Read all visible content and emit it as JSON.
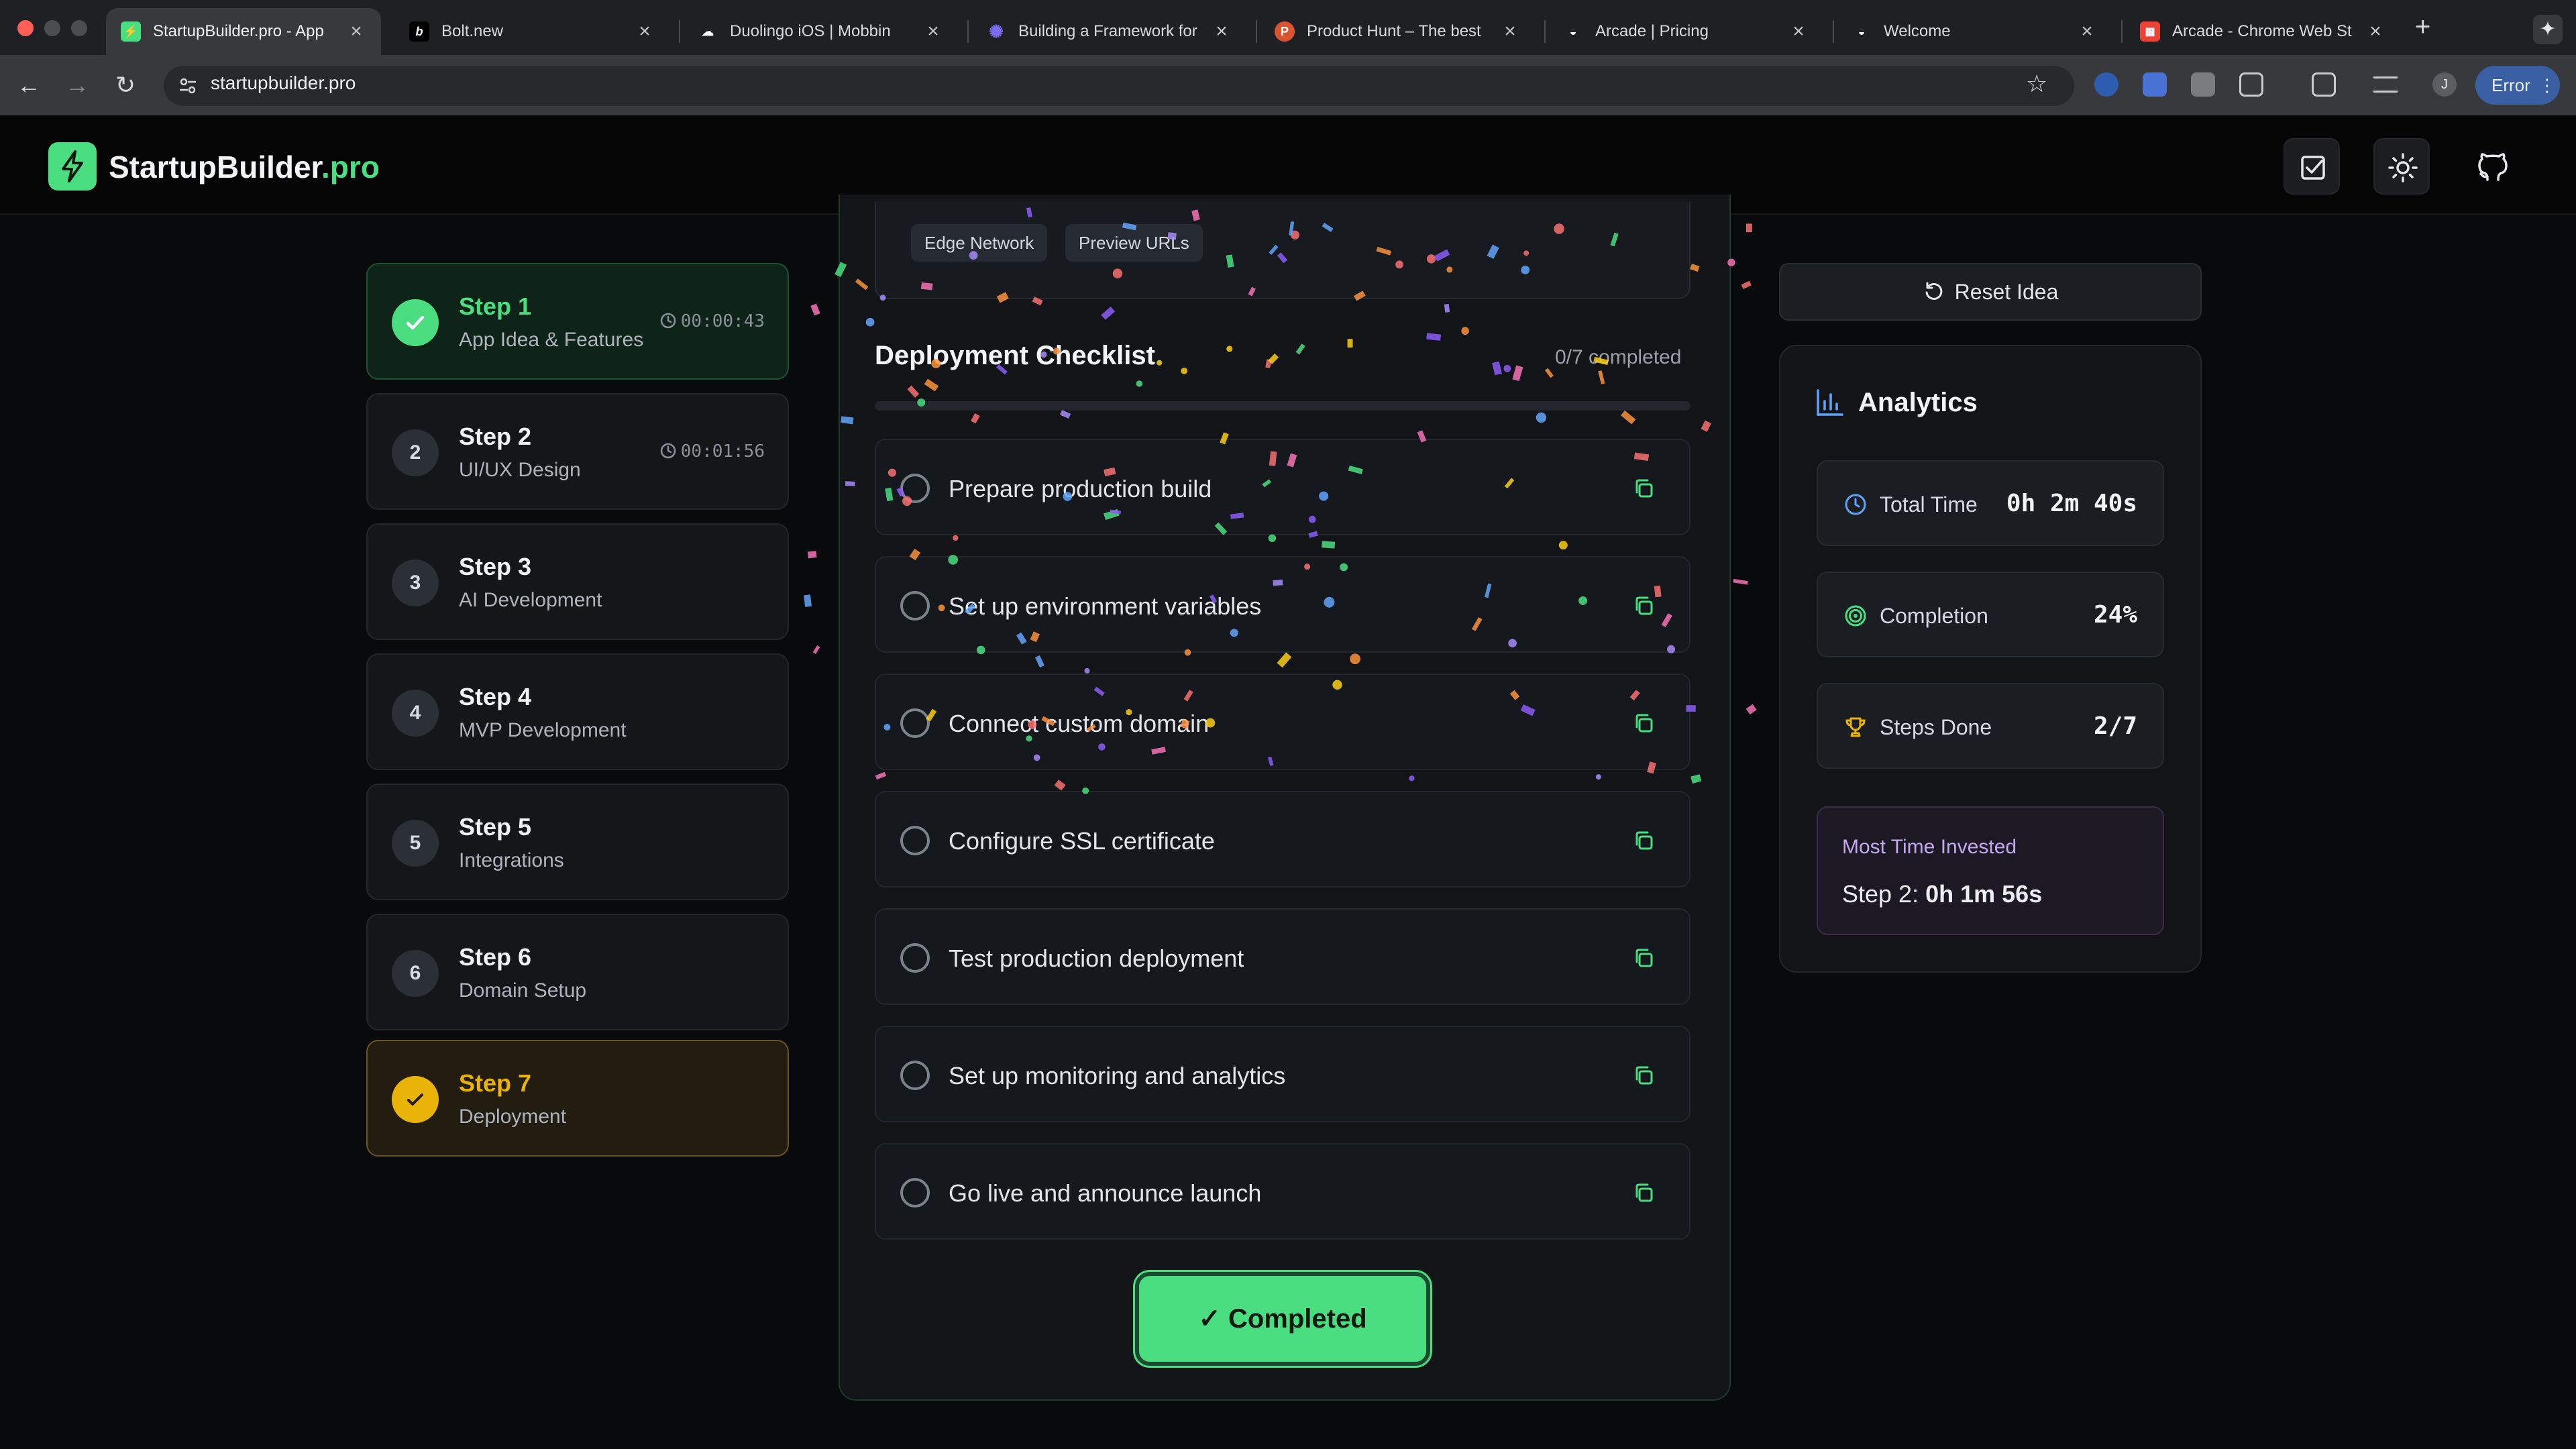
{
  "browser": {
    "tabs": [
      {
        "title": "StartupBuilder.pro - App",
        "icon": "bolt-favicon",
        "color": "#4ade80"
      },
      {
        "title": "Bolt.new",
        "icon": "b-favicon",
        "color": "#000000"
      },
      {
        "title": "Duolingo iOS | Mobbin",
        "icon": "cloud-favicon",
        "color": "#ffffff"
      },
      {
        "title": "Building a Framework for",
        "icon": "gear-favicon",
        "color": "#7c6cf0"
      },
      {
        "title": "Product Hunt – The best",
        "icon": "p-favicon",
        "color": "#da552f"
      },
      {
        "title": "Arcade | Pricing",
        "icon": "arcade-favicon",
        "color": "#ffffff"
      },
      {
        "title": "Welcome",
        "icon": "arcade-favicon",
        "color": "#ffffff"
      },
      {
        "title": "Arcade - Chrome Web St",
        "icon": "chrome-store-favicon",
        "color": "#ea4335"
      }
    ],
    "url": "startupbuilder.pro",
    "error_label": "Error",
    "profile_initial": "J"
  },
  "header": {
    "brand_main": "StartupBuilder",
    "brand_accent": ".pro"
  },
  "steps": [
    {
      "number": "1",
      "title": "Step 1",
      "subtitle": "App Idea & Features",
      "timer": "00:00:43",
      "state": "done"
    },
    {
      "number": "2",
      "title": "Step 2",
      "subtitle": "UI/UX Design",
      "timer": "00:01:56",
      "state": "pending"
    },
    {
      "number": "3",
      "title": "Step 3",
      "subtitle": "AI Development",
      "timer": "",
      "state": "pending"
    },
    {
      "number": "4",
      "title": "Step 4",
      "subtitle": "MVP Development",
      "timer": "",
      "state": "pending"
    },
    {
      "number": "5",
      "title": "Step 5",
      "subtitle": "Integrations",
      "timer": "",
      "state": "pending"
    },
    {
      "number": "6",
      "title": "Step 6",
      "subtitle": "Domain Setup",
      "timer": "",
      "state": "pending"
    },
    {
      "number": "7",
      "title": "Step 7",
      "subtitle": "Deployment",
      "timer": "",
      "state": "current"
    }
  ],
  "feature_tags": [
    "Edge Network",
    "Preview URLs"
  ],
  "checklist": {
    "title": "Deployment Checklist",
    "count": "0/7 completed",
    "progress": 0,
    "items": [
      "Prepare production build",
      "Set up environment variables",
      "Connect custom domain",
      "Configure SSL certificate",
      "Test production deployment",
      "Set up monitoring and analytics",
      "Go live and announce launch"
    ]
  },
  "complete_button": "✓ Completed",
  "reset_button": "Reset Idea",
  "analytics": {
    "title": "Analytics",
    "metrics": [
      {
        "label": "Total Time",
        "value": "0h 2m 40s",
        "icon": "clock-icon"
      },
      {
        "label": "Completion",
        "value": "24%",
        "icon": "target-icon"
      },
      {
        "label": "Steps Done",
        "value": "2/7",
        "icon": "trophy-icon"
      }
    ],
    "most_invested_label": "Most Time Invested",
    "most_invested_step": "Step 2:",
    "most_invested_value": "0h 1m 56s"
  },
  "colors": {
    "accent": "#4ade80",
    "current": "#eab308",
    "background": "#090a0c",
    "invested": "#c4a8f0"
  }
}
